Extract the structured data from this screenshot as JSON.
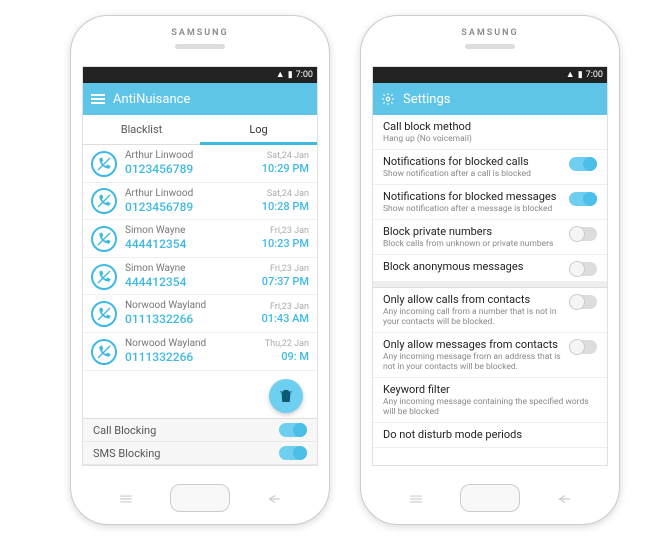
{
  "device": {
    "brand": "SAMSUNG",
    "time": "7:00"
  },
  "colors": {
    "accent": "#5ec5e8",
    "accent2": "#3fb9e3"
  },
  "left": {
    "title": "AntiNuisance",
    "tabs": {
      "blacklist": "Blacklist",
      "log": "Log"
    },
    "active_tab": "log",
    "log": [
      {
        "name": "Arthur Linwood",
        "number": "0123456789",
        "date": "Sat,24 Jan",
        "time": "10:29 PM",
        "type": "call"
      },
      {
        "name": "Arthur Linwood",
        "number": "0123456789",
        "date": "Sat,24 Jan",
        "time": "10:28 PM",
        "type": "call"
      },
      {
        "name": "Simon Wayne",
        "number": "444412354",
        "date": "Fri,23 Jan",
        "time": "10:23 PM",
        "type": "call"
      },
      {
        "name": "Simon Wayne",
        "number": "444412354",
        "date": "Fri,23 Jan",
        "time": "07:37 PM",
        "type": "call"
      },
      {
        "name": "Norwood Wayland",
        "number": "0111332266",
        "date": "Fri,23 Jan",
        "time": "01:43 AM",
        "type": "call"
      },
      {
        "name": "Norwood Wayland",
        "number": "0111332266",
        "date": "Thu,22 Jan",
        "time": "09:   M",
        "type": "call"
      }
    ],
    "bottom": {
      "call_blocking": "Call Blocking",
      "sms_blocking": "SMS Blocking"
    },
    "trash_icon": "trash-icon"
  },
  "right": {
    "title": "Settings",
    "items": [
      {
        "title": "Call block method",
        "sub": "Hang up (No voicemail)",
        "toggle": null
      },
      {
        "title": "Notifications for blocked calls",
        "sub": "Show notification after a call is blocked",
        "toggle": true
      },
      {
        "title": "Notifications for blocked messages",
        "sub": "Show notification after a message is blocked",
        "toggle": true
      },
      {
        "title": "Block private numbers",
        "sub": "Block calls from unknown or private numbers",
        "toggle": false
      },
      {
        "title": "Block anonymous messages",
        "sub": "",
        "toggle": false
      },
      {
        "gap": true
      },
      {
        "title": "Only allow calls from contacts",
        "sub": "Any incoming call from a number that is not in your contacts will be blocked.",
        "toggle": false
      },
      {
        "title": "Only allow messages from contacts",
        "sub": "Any incoming message from an address that is not in your contacts will be blocked.",
        "toggle": false
      },
      {
        "title": "Keyword filter",
        "sub": "Any incoming message containing the specified words will be blocked",
        "toggle": null
      },
      {
        "title": "Do not disturb mode periods",
        "sub": "",
        "toggle": null
      }
    ]
  }
}
